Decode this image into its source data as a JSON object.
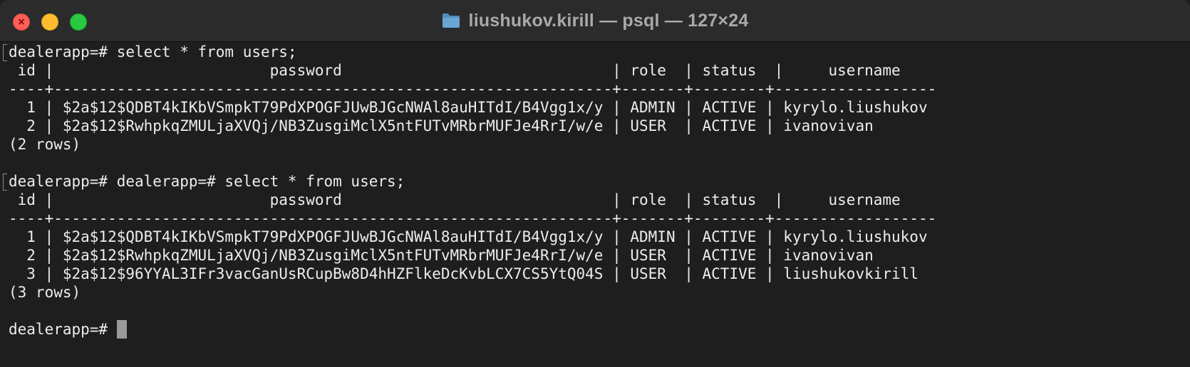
{
  "window": {
    "title": "liushukov.kirill — psql — 127×24",
    "folder_icon": "folder-icon",
    "close_glyph": "×"
  },
  "terminal": {
    "lines": [
      "dealerapp=# select * from users;",
      " id |                        password                              | role  | status  |     username",
      "----+--------------------------------------------------------------+-------+--------+------------------",
      "  1 | $2a$12$QDBT4kIKbVSmpkT79PdXPOGFJUwBJGcNWAl8auHITdI/B4Vgg1x/y | ADMIN | ACTIVE | kyrylo.liushukov",
      "  2 | $2a$12$RwhpkqZMULjaXVQj/NB3ZusgiMclX5ntFUTvMRbrMUFJe4RrI/w/e | USER  | ACTIVE | ivanovivan",
      "(2 rows)",
      "",
      "dealerapp=# dealerapp=# select * from users;",
      " id |                        password                              | role  | status  |     username",
      "----+--------------------------------------------------------------+-------+--------+------------------",
      "  1 | $2a$12$QDBT4kIKbVSmpkT79PdXPOGFJUwBJGcNWAl8auHITdI/B4Vgg1x/y | ADMIN | ACTIVE | kyrylo.liushukov",
      "  2 | $2a$12$RwhpkqZMULjaXVQj/NB3ZusgiMclX5ntFUTvMRbrMUFJe4RrI/w/e | USER  | ACTIVE | ivanovivan",
      "  3 | $2a$12$96YYAL3IFr3vacGanUsRCupBw8D4hHZFlkeDcKvbLCX7CS5YtQ04S | USER  | ACTIVE | liushukovkirill",
      "(3 rows)",
      "",
      "dealerapp=# "
    ]
  }
}
